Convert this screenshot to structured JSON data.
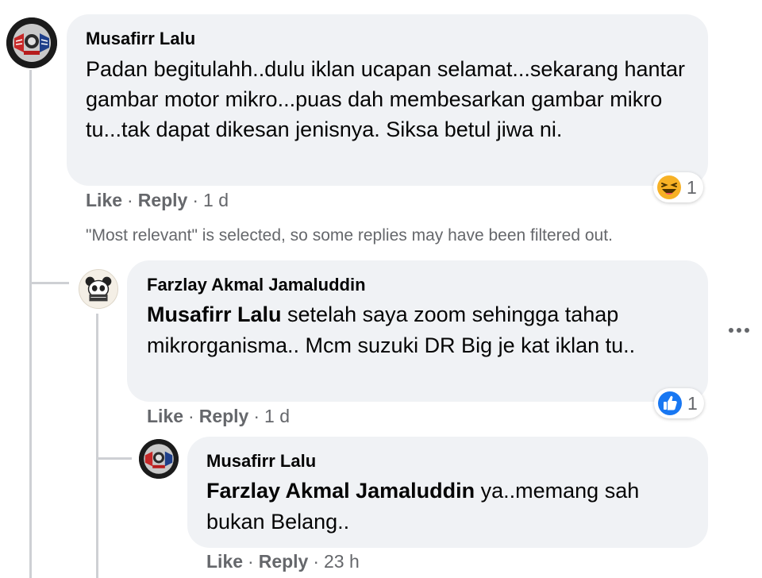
{
  "comment": {
    "author": "Musafirr Lalu",
    "text": "Padan begitulahh..dulu iklan ucapan selamat...sekarang hantar gambar motor mikro...puas dah membesarkan gambar mikro tu...tak dapat dikesan jenisnya. Siksa betul jiwa ni.",
    "like_label": "Like",
    "reply_label": "Reply",
    "separator": "·",
    "time": "1 d",
    "reaction": {
      "icon": "haha-emoji-icon",
      "count": "1"
    }
  },
  "filter_note": "\"Most relevant\" is selected, so some replies may have been filtered out.",
  "replies": [
    {
      "author": "Farzlay Akmal Jamaluddin",
      "mention": "Musafirr Lalu",
      "text": " setelah saya zoom sehingga tahap mikrorganisma.. Mcm suzuki DR Big je kat iklan tu..",
      "like_label": "Like",
      "reply_label": "Reply",
      "separator": "·",
      "time": "1 d",
      "reaction": {
        "icon": "like-thumb-icon",
        "count": "1"
      }
    },
    {
      "author": "Musafirr Lalu",
      "mention": "Farzlay Akmal Jamaluddin",
      "text": " ya..memang sah bukan Belang..",
      "like_label": "Like",
      "reply_label": "Reply",
      "separator": "·",
      "time": "23 h"
    }
  ],
  "more_options_icon": "more-horizontal-icon",
  "colors": {
    "bubble": "#f0f2f5",
    "secondary_text": "#65676b",
    "like_blue": "#1877f2",
    "haha_yellow": "#f7b125",
    "thread_line": "#ced0d4"
  }
}
